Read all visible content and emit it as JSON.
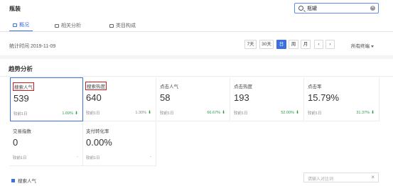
{
  "breadcrumb": "瓶装",
  "search": {
    "value": "瓶罐",
    "clear": "×"
  },
  "tabs": [
    {
      "label": "概况",
      "active": true
    },
    {
      "label": "相关分析",
      "active": false
    },
    {
      "label": "类目构成",
      "active": false
    }
  ],
  "stat_time": "统计时间 2019-11-09",
  "period_buttons": [
    {
      "label": "7天",
      "active": false
    },
    {
      "label": "30天",
      "active": false
    },
    {
      "label": "日",
      "active": true
    },
    {
      "label": "周",
      "active": false
    },
    {
      "label": "月",
      "active": false
    },
    {
      "label": "‹",
      "active": false
    },
    {
      "label": "›",
      "active": false
    }
  ],
  "terminal": "所有终端",
  "section_title": "趋势分析",
  "metrics": [
    {
      "name": "搜索人气",
      "value": "539",
      "compare": "较前1日",
      "pct": "1.69%",
      "trend": "up",
      "boxed": true
    },
    {
      "name": "搜索热度",
      "value": "640",
      "compare": "较前1日",
      "pct": "1.30%",
      "trend": "up",
      "boxed": true
    },
    {
      "name": "点击人气",
      "value": "58",
      "compare": "较前1日",
      "pct": "66.67%",
      "trend": "up",
      "boxed": false
    },
    {
      "name": "点击热度",
      "value": "193",
      "compare": "较前1日",
      "pct": "52.00%",
      "trend": "up",
      "boxed": false
    },
    {
      "name": "点击率",
      "value": "15.79%",
      "compare": "较前1日",
      "pct": "31.37%",
      "trend": "up",
      "boxed": false
    },
    {
      "name": "交易指数",
      "value": "0",
      "compare": "较前1日",
      "pct": "-",
      "trend": "none",
      "boxed": false
    },
    {
      "name": "支付转化率",
      "value": "0.00%",
      "compare": "较前1日",
      "pct": "-",
      "trend": "none",
      "boxed": false
    }
  ],
  "legend_label": "搜索人气",
  "compare_input": {
    "placeholder": "请输入对比词",
    "clear": "×"
  },
  "colors": {
    "accent": "#3a6fe0",
    "up": "#2e9a4a",
    "highlight_box": "#c81e1e"
  }
}
